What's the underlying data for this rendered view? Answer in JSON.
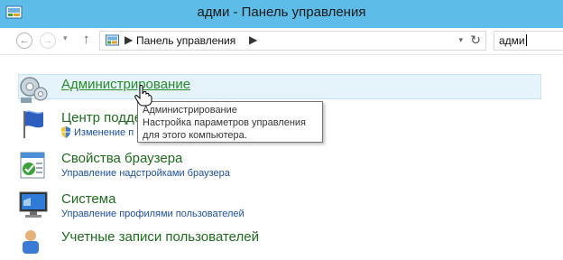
{
  "window": {
    "title": "адми - Панель управления"
  },
  "nav": {
    "back": "←",
    "forward": "→",
    "dropdown": "▾",
    "up": "↑",
    "address_sep": "▶",
    "address_text": "Панель управления",
    "address_drop": "▾",
    "refresh": "↻",
    "search_value": "адми"
  },
  "items": [
    {
      "title": "Администрирование",
      "sub": ""
    },
    {
      "title": "Центр подде",
      "sub": "Изменение п"
    },
    {
      "title": "Свойства браузера",
      "sub": "Управление надстройками браузера"
    },
    {
      "title": "Система",
      "sub": "Управление профилями пользователей"
    },
    {
      "title": "Учетные записи пользователей",
      "sub": ""
    }
  ],
  "tooltip": {
    "line1": "Администрирование",
    "line2": "Настройка параметров управления",
    "line3": "для этого компьютера."
  },
  "colors": {
    "titlebar": "#5dbce8",
    "item_title": "#1e6b1e",
    "item_link": "#1e4fa0",
    "hover_bg": "#e5f3fb"
  },
  "icons": [
    "control-panel-icon",
    "admin-tools-icon",
    "action-center-flag-icon",
    "uac-shield-icon",
    "browser-properties-icon",
    "system-monitor-icon",
    "user-accounts-icon",
    "hand-cursor-icon"
  ]
}
